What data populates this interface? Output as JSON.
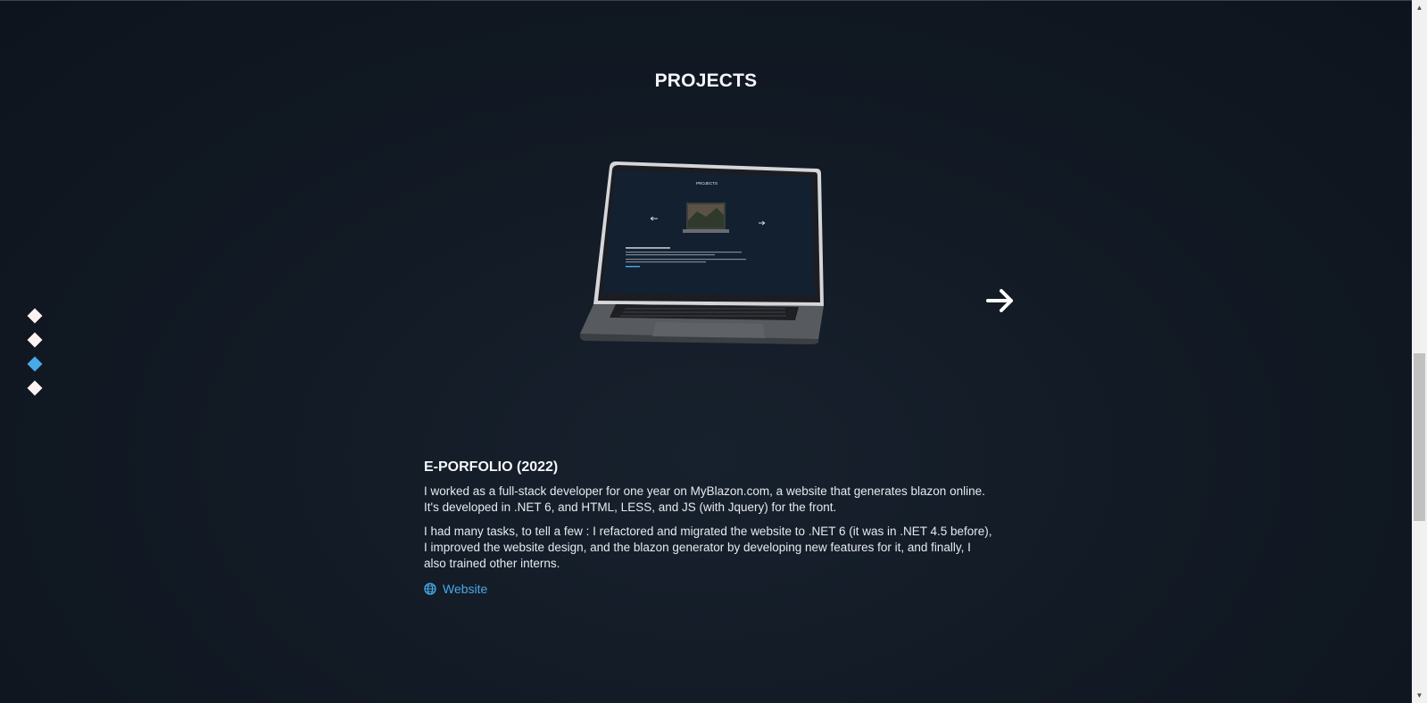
{
  "section": {
    "title": "PROJECTS"
  },
  "side_nav": {
    "items": [
      {
        "active": false
      },
      {
        "active": false
      },
      {
        "active": true
      },
      {
        "active": false
      }
    ],
    "active_color": "#49a9e9",
    "inactive_color": "#fbf2f2"
  },
  "carousel": {
    "next_icon": "arrow-right-icon"
  },
  "laptop_screen": {
    "title": "PROJECTS"
  },
  "project": {
    "title": "E-PORFOLIO (2022)",
    "paragraph_1": "I worked as a full-stack developer for one year on MyBlazon.com, a website that generates blazon online. It's developed in .NET 6, and HTML, LESS, and JS (with Jquery) for the front.",
    "paragraph_2": "I had many tasks, to tell a few : I refactored and migrated the website to .NET 6 (it was in .NET 4.5 before), I improved the website design, and the blazon generator by developing new features for it, and finally, I also trained other interns.",
    "link_label": "Website",
    "link_icon": "globe-icon"
  },
  "colors": {
    "accent": "#49a9e9",
    "background": "#121a25"
  }
}
